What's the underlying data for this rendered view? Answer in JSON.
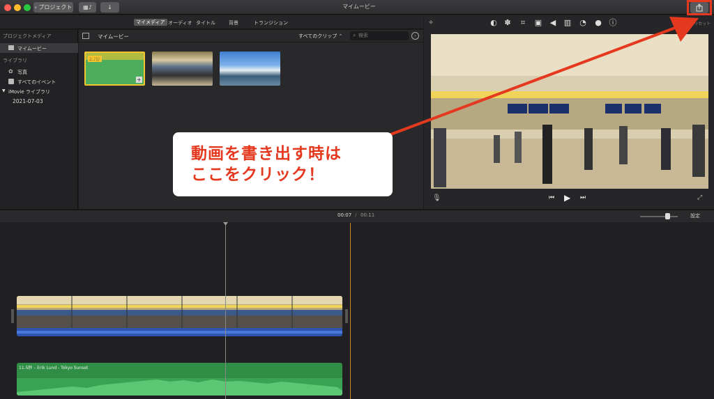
{
  "window": {
    "title": "マイムービー"
  },
  "toolbar": {
    "back_label": "プロジェクト",
    "media_icon": "film-music-icon",
    "import_icon": "download-arrow-icon",
    "share_icon": "share-icon"
  },
  "browser": {
    "tabs": [
      "マイメディア",
      "オーディオ",
      "タイトル",
      "背景",
      "トランジション"
    ],
    "header_title": "マイムービー",
    "filter_label": "すべてのクリップ",
    "search_placeholder": "検索"
  },
  "sidebar": {
    "project_media_heading": "プロジェクトメディア",
    "project_item": "マイムービー",
    "library_heading": "ライブラリ",
    "photos": "写真",
    "all_events": "すべてのイベント",
    "library_name": "iMovie ライブラリ",
    "event_date": "2021-07-03"
  },
  "media_clips": [
    {
      "badge": "3.7秒",
      "kind": "audio"
    },
    {
      "badge": "",
      "kind": "station"
    },
    {
      "badge": "",
      "kind": "harbor"
    }
  ],
  "viewer": {
    "reset_label": "すべてをリセット",
    "tool_icons": [
      "magic-wand-icon",
      "color-balance-icon",
      "color-palette-icon",
      "crop-icon",
      "stabilization-icon",
      "volume-icon",
      "equalizer-icon",
      "speed-icon",
      "filter-icon",
      "info-icon"
    ]
  },
  "timeline": {
    "current_time": "00:07",
    "separator": "/",
    "total_time": "00:11",
    "settings_label": "設定",
    "audio_clip_label": "11.5秒 – Erik Lund - Tokyo Sunset",
    "zoom_level": 0.72
  },
  "callout": {
    "line1": "動画を書き出す時は",
    "line2": "ここをクリック！"
  },
  "colors": {
    "accent": "#e5391f",
    "audio_green": "#2f8d45",
    "selection": "#585858"
  }
}
